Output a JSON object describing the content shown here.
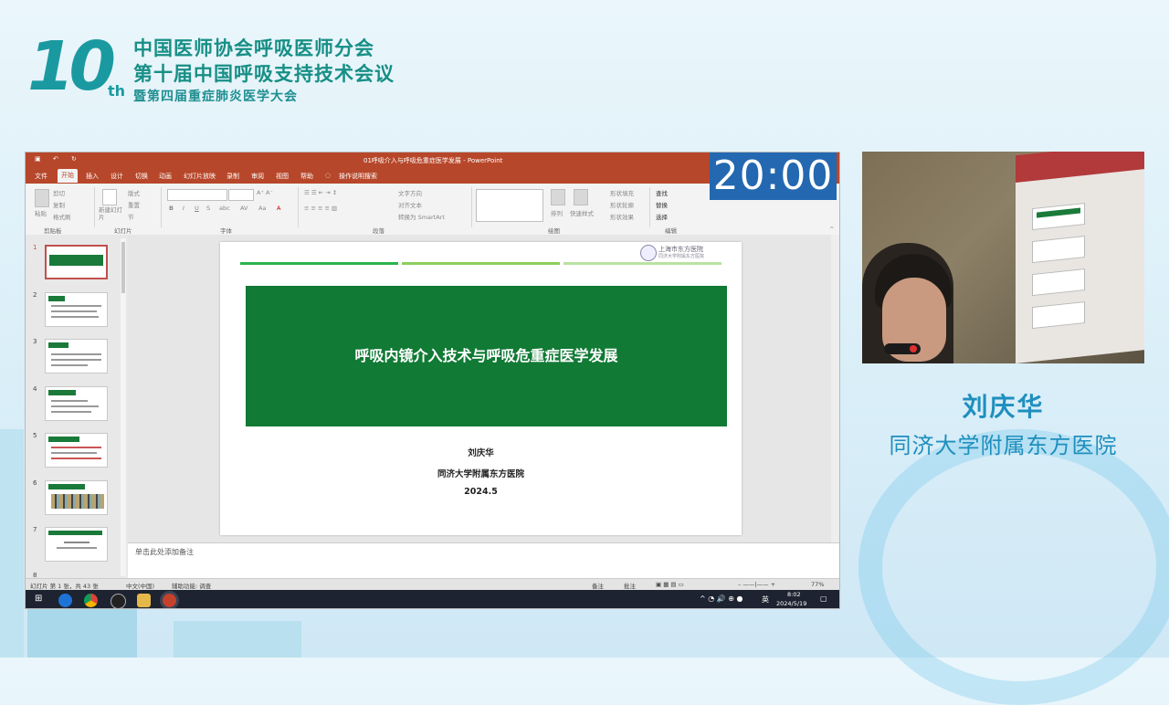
{
  "conference": {
    "logo_number": "10",
    "logo_suffix": "th",
    "line1": "中国医师协会呼吸医师分会",
    "line2": "第十届中国呼吸支持技术会议",
    "line3": "暨第四届重症肺炎医学大会"
  },
  "timer": "20:00",
  "speaker": {
    "name": "刘庆华",
    "organization": "同济大学附属东方医院"
  },
  "powerpoint": {
    "window_title": "01呼吸介入与呼吸危重症医学发展 - PowerPoint",
    "menu": [
      "文件",
      "开始",
      "插入",
      "设计",
      "切换",
      "动画",
      "幻灯片放映",
      "录制",
      "审阅",
      "视图",
      "帮助"
    ],
    "active_menu": "开始",
    "tell_me": "操作说明搜索",
    "ribbon_groups": {
      "clipboard": "剪贴板",
      "slides": "幻灯片",
      "font": "字体",
      "paragraph": "段落",
      "drawing": "绘图",
      "editing": "编辑"
    },
    "ribbon_buttons": {
      "paste": "粘贴",
      "cut": "剪切",
      "copy": "复制",
      "format_painter": "格式刷",
      "new_slide": "新建幻灯片",
      "layout": "版式",
      "reset": "重置",
      "section": "节",
      "text_direction": "文字方向",
      "align_text": "对齐文本",
      "smartart": "转换为 SmartArt",
      "arrange": "排列",
      "quick_styles": "快速样式",
      "shape_fill": "形状填充",
      "shape_outline": "形状轮廓",
      "shape_effects": "形状效果",
      "find": "查找",
      "replace": "替换",
      "select": "选择"
    },
    "thumbnail_numbers": [
      "1",
      "2",
      "3",
      "4",
      "5",
      "6",
      "7",
      "8"
    ],
    "slide": {
      "title": "呼吸内镜介入技术与呼吸危重症医学发展",
      "author": "刘庆华",
      "affiliation": "同济大学附属东方医院",
      "date": "2024.5",
      "seal_line1": "上海市东方医院",
      "seal_line2": "同济大学附属东方医院"
    },
    "notes_placeholder": "单击此处添加备注",
    "status": {
      "slide_count": "幻灯片 第 1 张，共 43 张",
      "language": "中文(中国)",
      "accessibility": "辅助功能: 调查",
      "notes": "备注",
      "comments": "批注",
      "zoom": "77%"
    },
    "taskbar": {
      "ime": "英",
      "time": "8:02",
      "date": "2024/5/19"
    }
  },
  "colors": {
    "accent_teal": "#178f86",
    "ppt_red": "#b7472a",
    "slide_green": "#117a35",
    "timer_blue": "#2368b0",
    "speaker_blue": "#1e8fbe"
  }
}
